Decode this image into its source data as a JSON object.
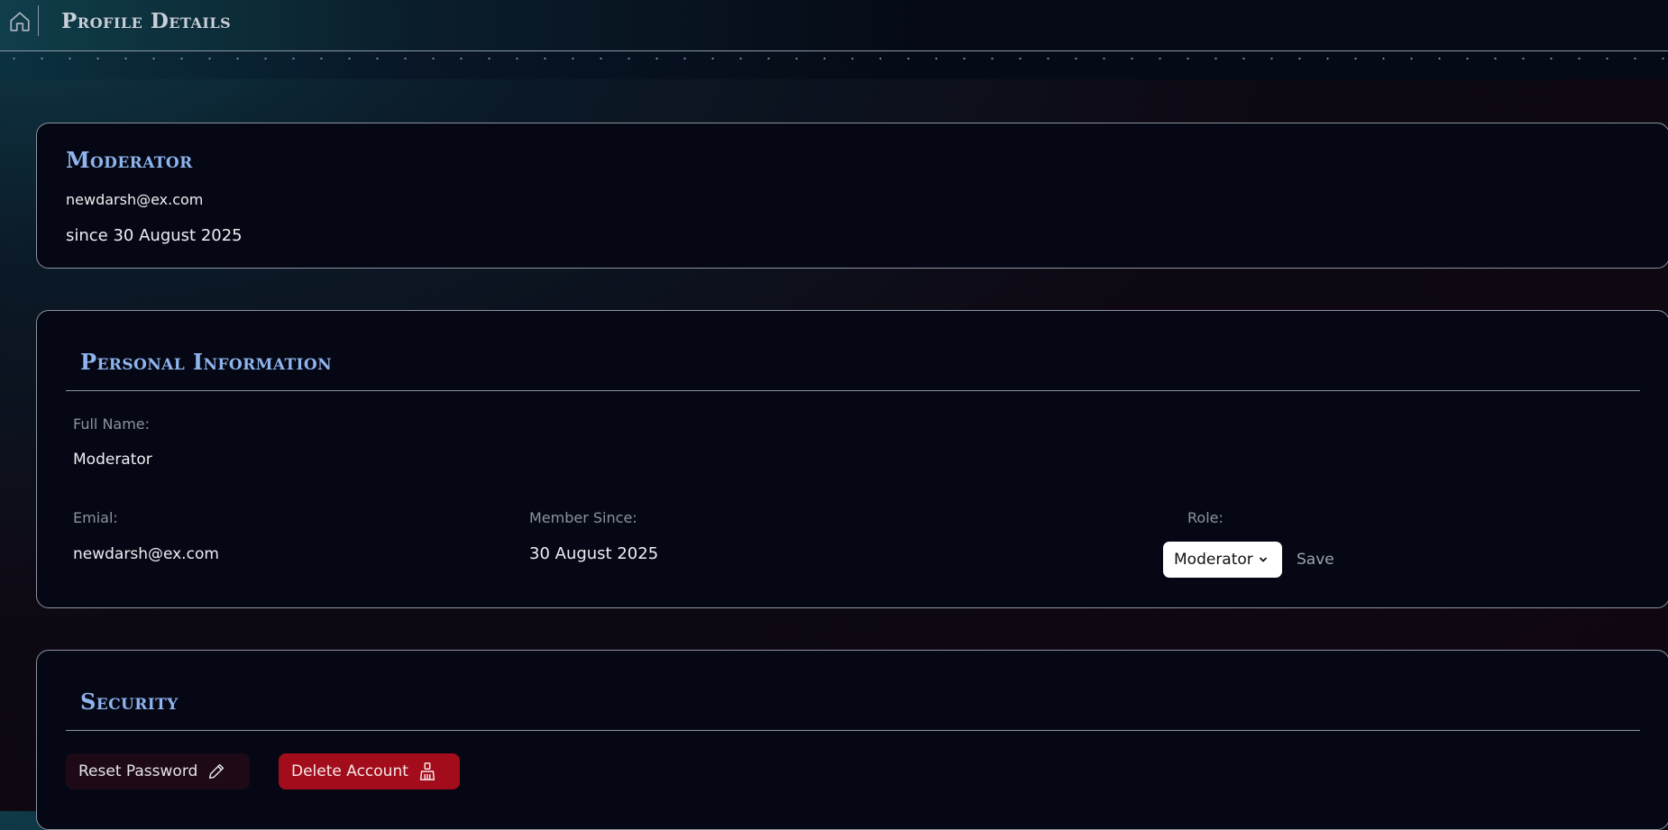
{
  "header": {
    "title": "Profile Details",
    "home_icon": "home-icon"
  },
  "summary": {
    "name": "Moderator",
    "email": "newdarsh@ex.com",
    "since": "since 30 August 2025"
  },
  "personal": {
    "title": "Personal Information",
    "full_name_label": "Full Name:",
    "full_name_value": "Moderator",
    "email_label": "Emial:",
    "email_value": "newdarsh@ex.com",
    "member_since_label": "Member Since:",
    "member_since_value": "30 August 2025",
    "role_label": "Role:",
    "role_selected": "Moderator",
    "save_label": "Save"
  },
  "security": {
    "title": "Security",
    "reset_label": "Reset Password",
    "reset_icon": "pencil-icon",
    "delete_label": "Delete Account",
    "delete_icon": "broom-icon"
  },
  "colors": {
    "accent_title": "#8fb4ee",
    "danger": "#a30d1b",
    "card_bg": "#050814"
  }
}
